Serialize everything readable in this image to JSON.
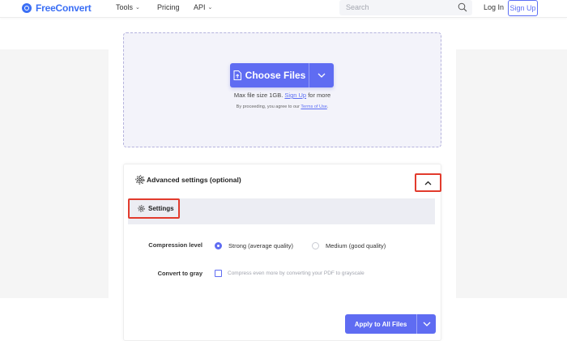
{
  "header": {
    "brand": "FreeConvert",
    "nav": [
      {
        "label": "Tools",
        "has_dropdown": true
      },
      {
        "label": "Pricing",
        "has_dropdown": false
      },
      {
        "label": "API",
        "has_dropdown": true
      }
    ],
    "search_placeholder": "Search",
    "login_label": "Log In",
    "signup_label": "Sign Up"
  },
  "upload": {
    "choose_label": "Choose Files",
    "max_size_prefix": "Max file size 1GB.",
    "max_size_link": "Sign Up",
    "max_size_suffix": "for more",
    "terms_prefix": "By proceeding, you agree to our",
    "terms_link": "Terms of Use",
    "terms_suffix": "."
  },
  "advanced": {
    "title": "Advanced settings (optional)",
    "settings_tab": "Settings",
    "compression": {
      "label": "Compression level",
      "options": [
        {
          "label": "Strong (average quality)",
          "selected": true
        },
        {
          "label": "Medium (good quality)",
          "selected": false
        }
      ]
    },
    "gray": {
      "label": "Convert to gray",
      "checked": false,
      "description": "Compress even more by converting your PDF to grayscale"
    },
    "apply_label": "Apply to All Files"
  },
  "colors": {
    "brand": "#3b6ff5",
    "accent": "#5f6cf2",
    "highlight": "#e23b2d"
  }
}
